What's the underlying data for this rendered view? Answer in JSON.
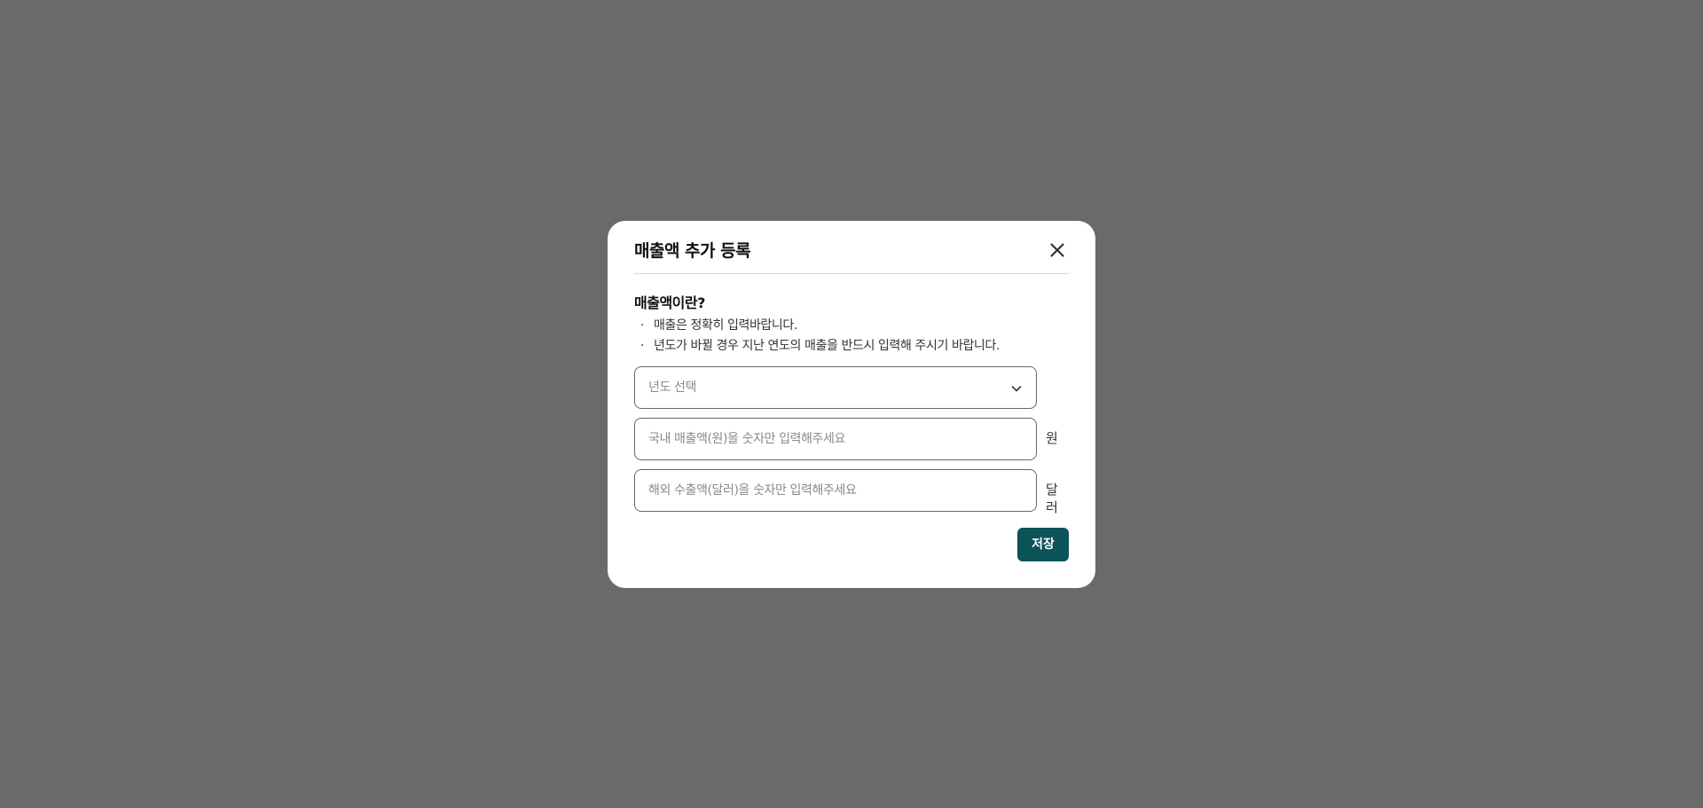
{
  "modal": {
    "title": "매출액 추가 등록",
    "close_icon": "close-icon",
    "info": {
      "title": "매출액이란?",
      "items": [
        "매출은 정확히 입력바랍니다.",
        "년도가 바뀔 경우 지난 연도의 매출을 반드시 입력해 주시기 바랍니다."
      ]
    },
    "year_select": {
      "placeholder": "년도 선택",
      "icon": "chevron-down-icon"
    },
    "domestic_sales": {
      "placeholder": "국내 매출액(원)을 숫자만 입력해주세요",
      "unit": "원"
    },
    "export_sales": {
      "placeholder": "해외 수출액(달러)을 숫자만 입력해주세요",
      "unit": "달러"
    },
    "save_label": "저장"
  },
  "colors": {
    "overlay": "#6a6a6a",
    "primary_button": "#0b5259"
  }
}
